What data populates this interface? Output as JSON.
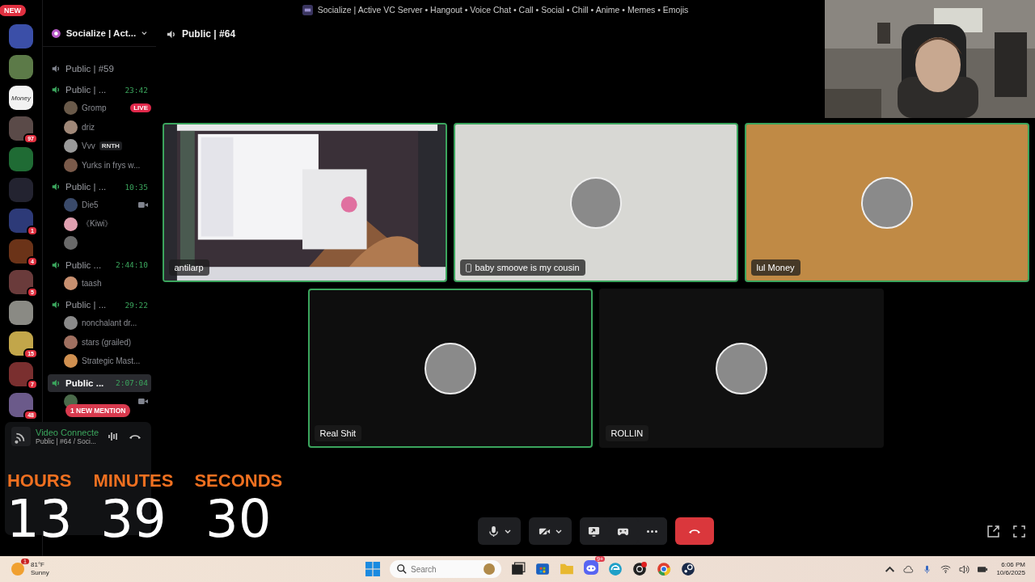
{
  "window": {
    "title": "Socialize | Active VC Server • Hangout • Voice Chat • Call • Social • Chill • Anime • Memes • Emojis"
  },
  "servers": [
    {
      "color": "#3b4fa8",
      "badge": "NEW"
    },
    {
      "color": "#5c7a48"
    },
    {
      "color": "#f2f2f2",
      "label": "Money"
    },
    {
      "color": "#5a4a48",
      "badge": "97"
    },
    {
      "color": "#1f6b34"
    },
    {
      "color": "#232330"
    },
    {
      "color": "#2d3a78",
      "badge": "1"
    },
    {
      "color": "#6b3318",
      "badge": "4"
    },
    {
      "color": "#6a3b3b",
      "badge": "5"
    },
    {
      "color": "#8a8a84"
    },
    {
      "color": "#c2a64a",
      "badge": "15"
    },
    {
      "color": "#7a2f2f",
      "badge": "7"
    },
    {
      "color": "#6b5a8a",
      "badge": "48"
    }
  ],
  "server_name": "Socialize | Act...",
  "channels": [
    {
      "name": "Public | #59",
      "active": false,
      "selected": false
    },
    {
      "name": "Public | ...",
      "time": "23:42",
      "active": true,
      "selected": false,
      "members": [
        {
          "name": "Gromp",
          "color": "#6a5a4a",
          "badge": "LIVE",
          "video": false
        },
        {
          "name": "driz",
          "color": "#a08878",
          "video": false
        },
        {
          "name": "Vvv",
          "color": "#9a9a9a",
          "tag": "RNTH",
          "video": false
        },
        {
          "name": "Yurks in frys w...",
          "color": "#7a5a4a",
          "video": false
        }
      ]
    },
    {
      "name": "Public | ...",
      "time": "10:35",
      "active": true,
      "selected": false,
      "members": [
        {
          "name": "Die5",
          "color": "#3a4a6a",
          "video": true
        },
        {
          "name": "《Kiwi》",
          "color": "#e0a0b0",
          "video": false
        },
        {
          "color": "#6a6a6a",
          "video": false
        }
      ]
    },
    {
      "name": "Public ...",
      "time": "2:44:10",
      "active": true,
      "selected": false,
      "members": [
        {
          "name": "taash",
          "color": "#c89070",
          "video": false
        }
      ]
    },
    {
      "name": "Public | ...",
      "time": "29:22",
      "active": true,
      "selected": false,
      "members": [
        {
          "name": "nonchalant dr...",
          "color": "#8a8a8a",
          "video": false
        },
        {
          "name": "stars (grailed)",
          "color": "#a07060",
          "video": false
        },
        {
          "name": "Strategic Mast...",
          "color": "#d09050",
          "video": false
        }
      ]
    },
    {
      "name": "Public ...",
      "time": "2:07:04",
      "active": true,
      "selected": true,
      "members": [
        {
          "color": "#4a6a4a",
          "video": true
        }
      ]
    }
  ],
  "mention": "1 NEW MENTION",
  "voice": {
    "status": "Video Connecte",
    "channel": "Public | #64 / Soci..."
  },
  "header": "Public | #64",
  "tiles": [
    {
      "kind": "screen",
      "name": "antilarp",
      "speaking": true,
      "mobile": false,
      "color": "#1a1a1a"
    },
    {
      "kind": "avatar",
      "name": "baby smoove is my cousin",
      "speaking": true,
      "mobile": true,
      "color": "#d8d8d4"
    },
    {
      "kind": "avatar",
      "name": "lul Money",
      "speaking": true,
      "mobile": false,
      "color": "#c08a45"
    },
    {
      "kind": "avatar",
      "name": "Real Shit",
      "speaking": true,
      "mobile": false,
      "color": "#0e0e0e"
    },
    {
      "kind": "avatar",
      "name": "ROLLIN",
      "speaking": false,
      "mobile": false,
      "color": "#101010"
    }
  ],
  "timer": [
    {
      "label": "HOURS",
      "value": "13"
    },
    {
      "label": "MINUTES",
      "value": "39"
    },
    {
      "label": "SECONDS",
      "value": "30"
    }
  ],
  "taskbar": {
    "temperature": "81°F",
    "weather": "Sunny",
    "weather_badge": "1",
    "search": {
      "placeholder": "Search"
    },
    "discord_badge": "9+",
    "time": "6:06 PM",
    "date": "10/6/2025"
  }
}
